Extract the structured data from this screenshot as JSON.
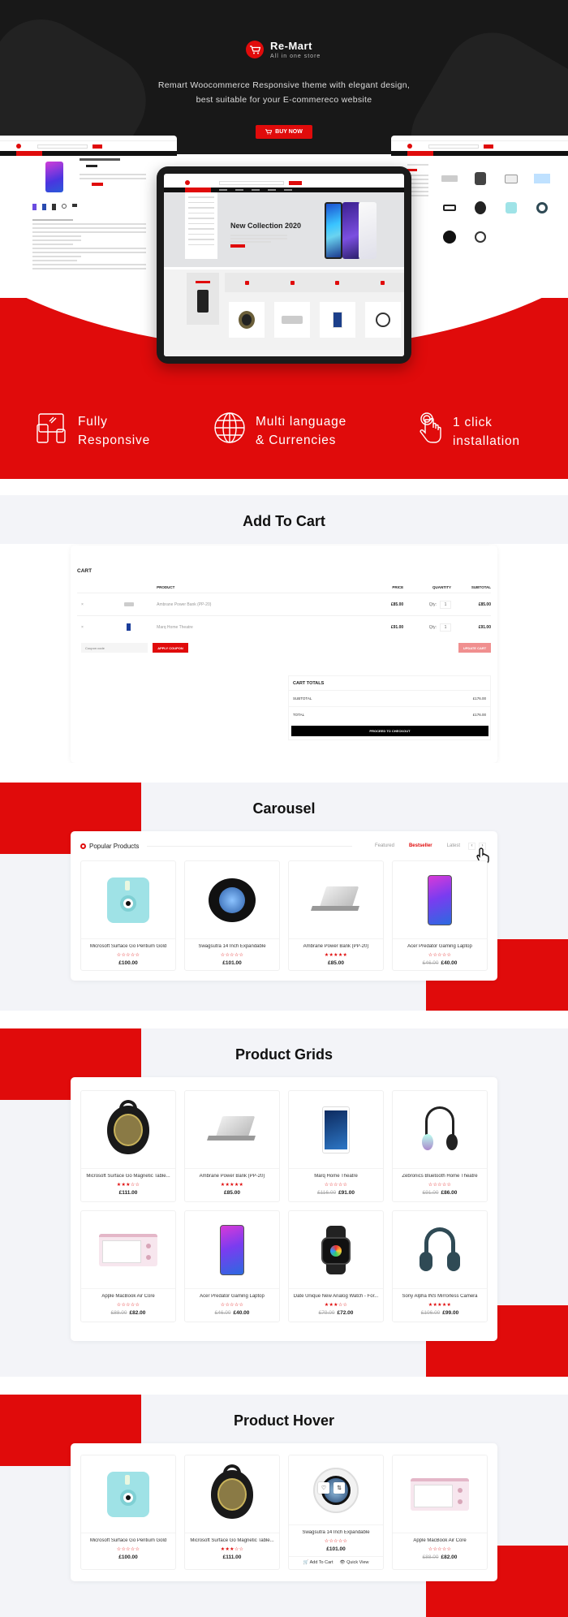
{
  "hero": {
    "brand_name": "Re-Mart",
    "brand_tagline": "All in one store",
    "description_line1": "Remart Woocommerce Responsive theme with elegant design,",
    "description_line2": "best suitable for your E-commereco website",
    "buy_button": "BUY NOW",
    "tablet_banner_title": "New Collection 2020"
  },
  "features": [
    {
      "icon": "responsive-devices-icon",
      "line1": "Fully",
      "line2": "Responsive"
    },
    {
      "icon": "globe-icon",
      "line1": "Multi language",
      "line2": "& Currencies"
    },
    {
      "icon": "tap-hand-icon",
      "line1": "1 click",
      "line2": "installation"
    }
  ],
  "add_to_cart": {
    "section_title": "Add To Cart",
    "cart_label": "CART",
    "columns": [
      "PRODUCT",
      "PRICE",
      "QUANTITY",
      "SUBTOTAL"
    ],
    "rows": [
      {
        "remove": "×",
        "name": "Ambrane Power Bank (PP-20)",
        "price": "£85.00",
        "qty_label": "Qty:",
        "qty": "1",
        "subtotal": "£85.00"
      },
      {
        "remove": "×",
        "name": "Marq Home Theatre",
        "price": "£91.00",
        "qty_label": "Qty:",
        "qty": "1",
        "subtotal": "£91.00"
      }
    ],
    "coupon_placeholder": "Coupon code",
    "apply_coupon": "APPLY COUPON",
    "update_cart": "UPDATE CART",
    "totals_title": "CART TOTALS",
    "subtotal_label": "SUBTOTAL",
    "subtotal_value": "£176.00",
    "total_label": "TOTAL",
    "total_value": "£176.00",
    "checkout": "PROCEED TO CHECKOUT"
  },
  "carousel": {
    "section_title": "Carousel",
    "block_title": "Popular Products",
    "tabs": [
      "Featured",
      "Bestseller",
      "Latest"
    ],
    "active_tab": "Bestseller",
    "prev": "‹",
    "next": "›",
    "products": [
      {
        "name": "Microsoft Surface Go Pentium Gold",
        "rating": 0,
        "old_price": "",
        "price": "£100.00"
      },
      {
        "name": "Swagsutra 14 Inch Expandable",
        "rating": 0,
        "old_price": "",
        "price": "£101.00"
      },
      {
        "name": "Ambrane Power Bank (PP-20)",
        "rating": 5,
        "old_price": "",
        "price": "£85.00"
      },
      {
        "name": "Acer Predator Gaming Laptop",
        "rating": 0,
        "old_price": "£46.00",
        "price": "£40.00"
      }
    ]
  },
  "grids": {
    "section_title": "Product Grids",
    "products": [
      {
        "name": "Microsoft Surface Go Magnetic Table...",
        "rating": 3,
        "old_price": "",
        "price": "£111.00"
      },
      {
        "name": "Ambrane Power Bank (PP-20)",
        "rating": 5,
        "old_price": "",
        "price": "£85.00"
      },
      {
        "name": "Marq Home Theatre",
        "rating": 0,
        "old_price": "£116.00",
        "price": "£91.00"
      },
      {
        "name": "Zebronics Bluetooth Home Theatre",
        "rating": 0,
        "old_price": "£91.00",
        "price": "£86.00"
      },
      {
        "name": "Apple MacBook Air Core",
        "rating": 0,
        "old_price": "£88.00",
        "price": "£82.00"
      },
      {
        "name": "Acer Predator Gaming Laptop",
        "rating": 0,
        "old_price": "£46.00",
        "price": "£40.00"
      },
      {
        "name": "Date Unique New Analog Watch - For...",
        "rating": 3,
        "old_price": "£79.00",
        "price": "£72.00"
      },
      {
        "name": "Sony Alpha INS Mirrorless Camera",
        "rating": 5,
        "old_price": "£106.00",
        "price": "£99.00"
      }
    ]
  },
  "hover": {
    "section_title": "Product Hover",
    "add_to_cart": "Add To Cart",
    "quick_view": "Quick View",
    "products": [
      {
        "name": "Microsoft Surface Go Pentium Gold",
        "rating": 0,
        "old_price": "",
        "price": "£100.00"
      },
      {
        "name": "Microsoft Surface Go Magnetic Table...",
        "rating": 3,
        "old_price": "",
        "price": "£111.00"
      },
      {
        "name": "Swagsutra 14 Inch Expandable",
        "rating": 0,
        "old_price": "",
        "price": "£101.00"
      },
      {
        "name": "Apple MacBook Air Core",
        "rating": 0,
        "old_price": "£88.00",
        "price": "£82.00"
      }
    ]
  },
  "colors": {
    "accent": "#e00b0b",
    "dark": "#181818",
    "page_bg": "#f3f4f8"
  }
}
